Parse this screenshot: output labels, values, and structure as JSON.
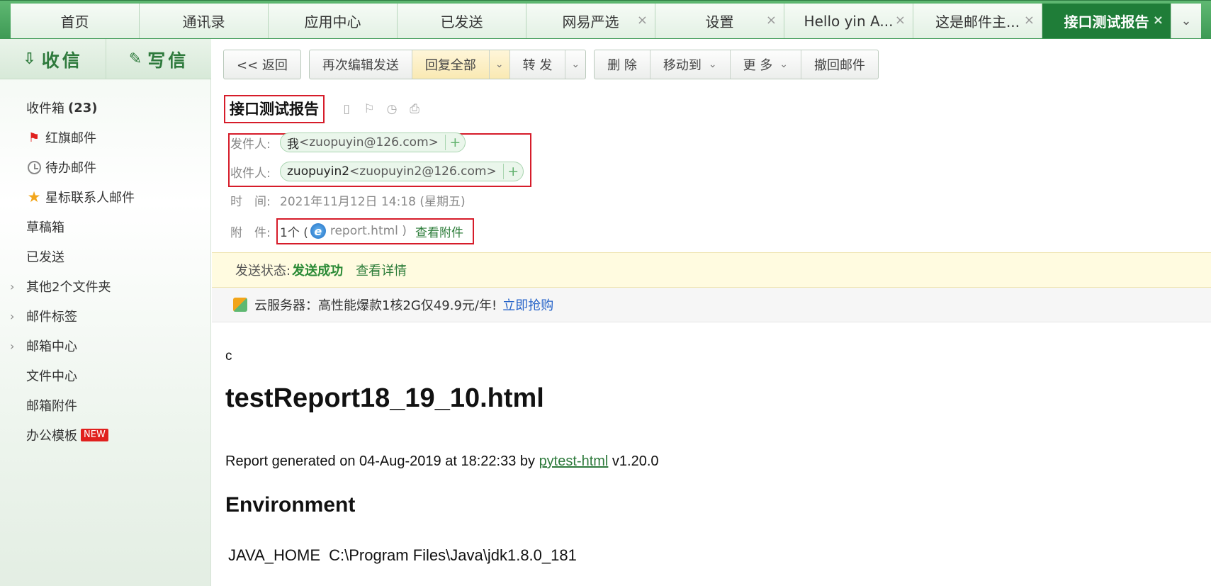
{
  "tabs": [
    {
      "label": "首页",
      "closable": false,
      "active": false
    },
    {
      "label": "通讯录",
      "closable": false,
      "active": false
    },
    {
      "label": "应用中心",
      "closable": false,
      "active": false
    },
    {
      "label": "已发送",
      "closable": false,
      "active": false
    },
    {
      "label": "网易严选",
      "closable": true,
      "active": false
    },
    {
      "label": "设置",
      "closable": true,
      "active": false
    },
    {
      "label": "Hello yin A...",
      "closable": true,
      "active": false
    },
    {
      "label": "这是邮件主...",
      "closable": true,
      "active": false
    },
    {
      "label": "接口测试报告",
      "closable": true,
      "active": true
    }
  ],
  "tab_close_glyph": "×",
  "tab_more_glyph": "⌄",
  "compose": {
    "receive": "收信",
    "write": "写信"
  },
  "folders": {
    "inbox": "收件箱",
    "inbox_count": "(23)",
    "flagged": "红旗邮件",
    "todo": "待办邮件",
    "starred": "星标联系人邮件",
    "drafts": "草稿箱",
    "sent": "已发送",
    "other": "其他2个文件夹",
    "tags": "邮件标签",
    "center": "邮箱中心",
    "files": "文件中心",
    "attachments": "邮箱附件",
    "templates": "办公模板",
    "new_badge": "NEW"
  },
  "toolbar": {
    "back": "<< 返回",
    "reedit": "再次编辑发送",
    "reply_all": "回复全部",
    "forward": "转 发",
    "delete": "删 除",
    "move": "移动到",
    "more": "更 多",
    "recall": "撤回邮件"
  },
  "mail": {
    "subject": "接口测试报告",
    "from_label": "发件人:",
    "from_name": "我",
    "from_email": "<zuopuyin@126.com>",
    "to_label": "收件人:",
    "to_name": "zuopuyin2",
    "to_email": "<zuopuyin2@126.com>",
    "time_label": "时　间:",
    "time_value": "2021年11月12日 14:18 (星期五)",
    "attach_label": "附　件:",
    "attach_count": "1个 (",
    "attach_name": "report.html )",
    "attach_link": "查看附件"
  },
  "status": {
    "label": "发送状态:",
    "value": "发送成功",
    "detail": "查看详情"
  },
  "ad": {
    "text": "云服务器：高性能爆款1核2G仅49.9元/年!",
    "link": "立即抢购"
  },
  "body": {
    "line1": "c",
    "title": "testReport18_19_10.html",
    "generated_prefix": "Report generated on 04-Aug-2019 at 18:22:33 by ",
    "generated_link": "pytest-html",
    "generated_suffix": " v1.20.0",
    "env_heading": "Environment",
    "env_key": "JAVA_HOME",
    "env_value": "C:\\Program Files\\Java\\jdk1.8.0_181"
  },
  "colors": {
    "brand_green": "#3e9a55",
    "active_tab": "#1f7d38",
    "highlight_red": "#d61c2a"
  }
}
